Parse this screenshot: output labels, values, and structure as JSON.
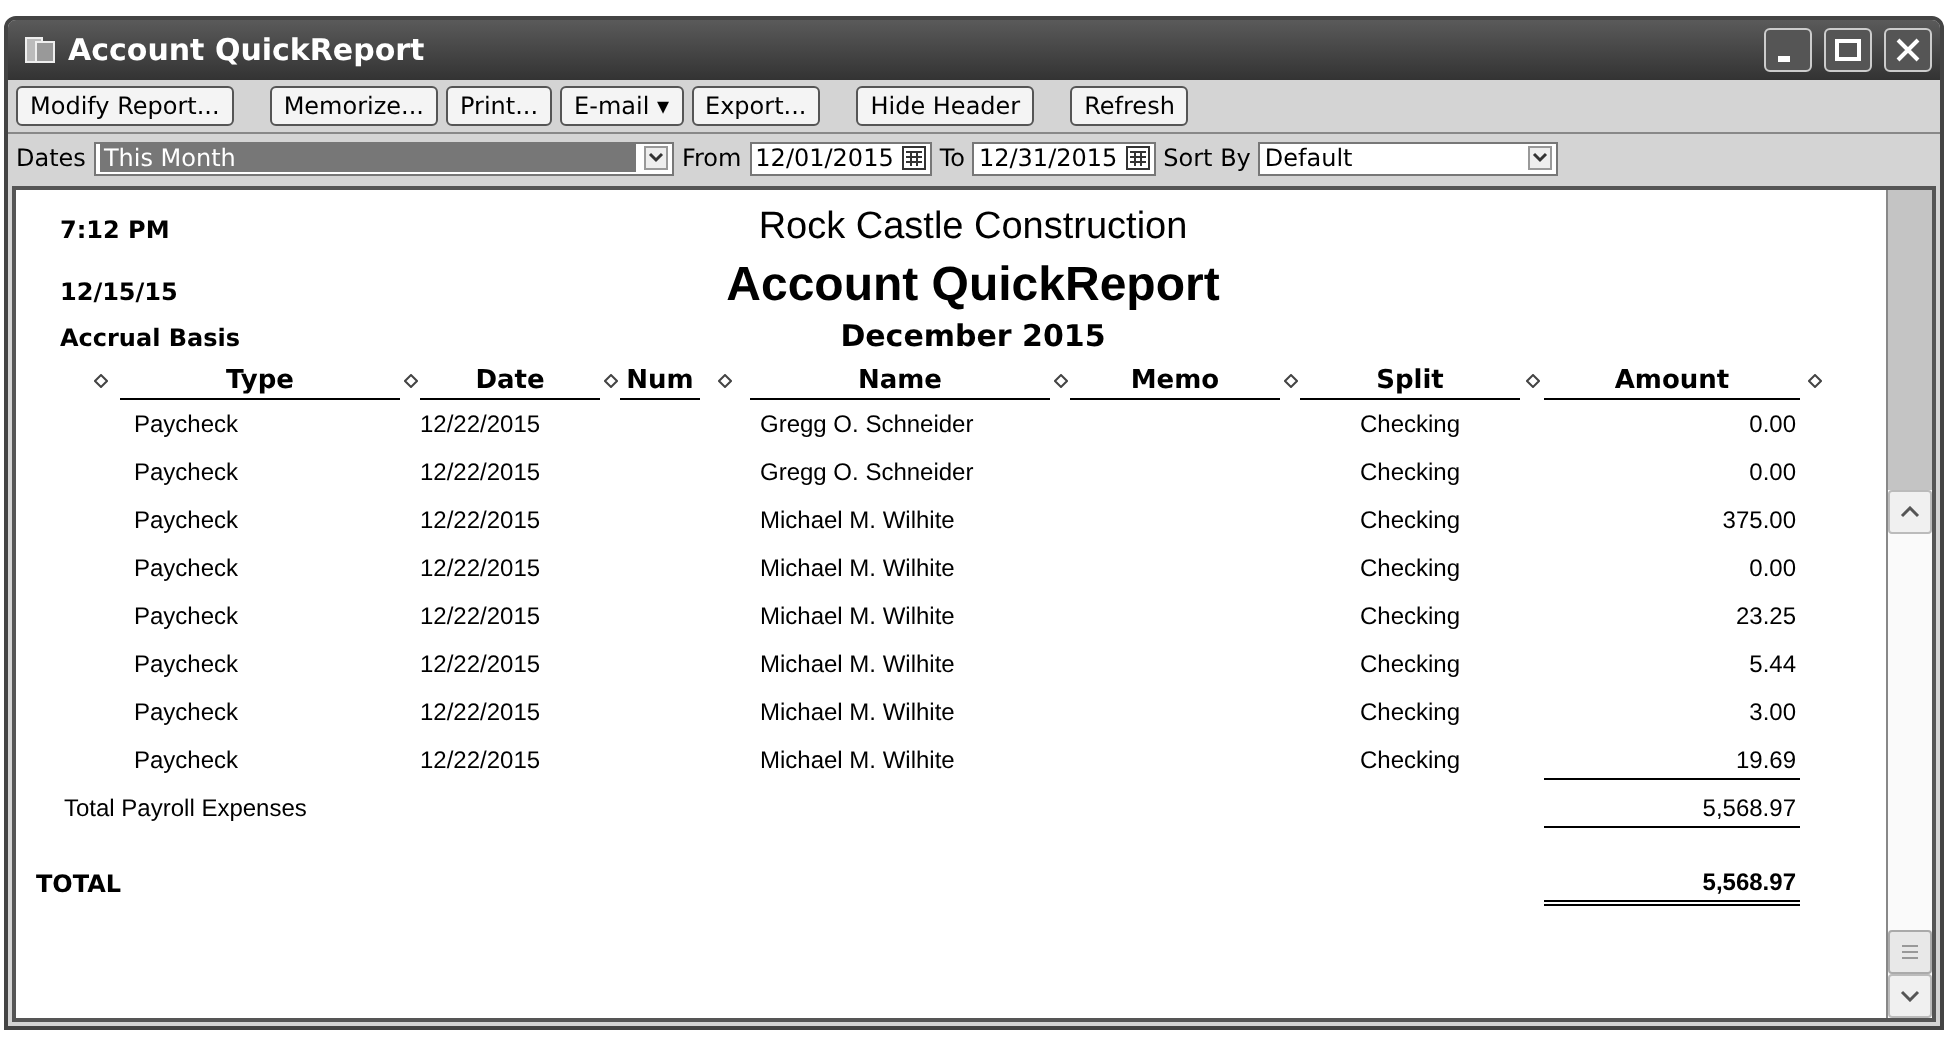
{
  "window": {
    "title": "Account QuickReport"
  },
  "toolbar": [
    "Modify Report...",
    "Memorize...",
    "Print...",
    "E-mail ▾",
    "Export...",
    "Hide Header",
    "Refresh"
  ],
  "filters": {
    "dates_label": "Dates",
    "dates_value": "This Month",
    "from_label": "From",
    "from_value": "12/01/2015",
    "to_label": "To",
    "to_value": "12/31/2015",
    "sort_label": "Sort By",
    "sort_value": "Default"
  },
  "report": {
    "time": "7:12 PM",
    "date": "12/15/15",
    "basis": "Accrual Basis",
    "company": "Rock Castle Construction",
    "title": "Account QuickReport",
    "period": "December 2015",
    "columns": [
      "Type",
      "Date",
      "Num",
      "Name",
      "Memo",
      "Split",
      "Amount"
    ],
    "rows": [
      {
        "type": "Paycheck",
        "date": "12/22/2015",
        "name": "Gregg O. Schneider",
        "split": "Checking",
        "amount": "0.00",
        "underlined": false
      },
      {
        "type": "Paycheck",
        "date": "12/22/2015",
        "name": "Gregg O. Schneider",
        "split": "Checking",
        "amount": "0.00",
        "underlined": false
      },
      {
        "type": "Paycheck",
        "date": "12/22/2015",
        "name": "Michael M. Wilhite",
        "split": "Checking",
        "amount": "375.00",
        "underlined": false
      },
      {
        "type": "Paycheck",
        "date": "12/22/2015",
        "name": "Michael M. Wilhite",
        "split": "Checking",
        "amount": "0.00",
        "underlined": false
      },
      {
        "type": "Paycheck",
        "date": "12/22/2015",
        "name": "Michael M. Wilhite",
        "split": "Checking",
        "amount": "23.25",
        "underlined": false
      },
      {
        "type": "Paycheck",
        "date": "12/22/2015",
        "name": "Michael M. Wilhite",
        "split": "Checking",
        "amount": "5.44",
        "underlined": false
      },
      {
        "type": "Paycheck",
        "date": "12/22/2015",
        "name": "Michael M. Wilhite",
        "split": "Checking",
        "amount": "3.00",
        "underlined": false
      },
      {
        "type": "Paycheck",
        "date": "12/22/2015",
        "name": "Michael M. Wilhite",
        "split": "Checking",
        "amount": "19.69",
        "underlined": true
      }
    ],
    "subtotal": {
      "label": "Total Payroll Expenses",
      "amount": "5,568.97"
    },
    "total": {
      "label": "TOTAL",
      "amount": "5,568.97"
    }
  }
}
